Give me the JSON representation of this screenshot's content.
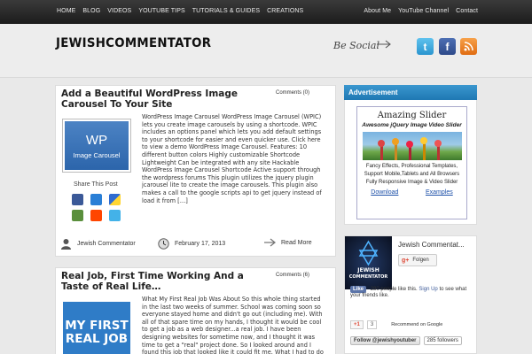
{
  "nav": {
    "left": [
      "HOME",
      "BLOG",
      "VIDEOS",
      "YOUTUBE TIPS",
      "TUTORIALS & GUIDES",
      "CREATIONS"
    ],
    "right": [
      "About Me",
      "YouTube Channel",
      "Contact"
    ]
  },
  "header": {
    "logo": "JEWISHCOMMENTATOR",
    "be_social": "Be Social"
  },
  "posts": [
    {
      "title": "Add a Beautiful WordPress Image Carousel To Your Site",
      "comments": "Comments (0)",
      "thumb_big": "WP",
      "thumb_small": "Image Carousel",
      "share_label": "Share This Post",
      "excerpt": "WordPress Image Carousel WordPress Image Carousel (WPIC) lets you create image carousels by using a shortcode. WPIC includes an options panel which lets you add default settings to your shortcode for easier and even quicker use.       Click here to view a demo WordPress Image Carousel. Features: 10 different button colors Highly customizable Shortcode Lightweight Can be integrated with any site Hackable WordPress Image Carousel Shortcode Active support through the wordpress forums This plugin utilizes the jquery plugin jcarousel lite to create the image carousels. This plugin also makes a call to the google scripts api to get jquery instead of load it from […]",
      "author": "Jewish Commentator",
      "date": "February 17, 2013",
      "read_more": "Read More"
    },
    {
      "title": "Real Job, First Time Working And a Taste of Real Life…",
      "comments": "Comments (6)",
      "thumb_text": [
        "MY FIRST",
        "REAL JOB"
      ],
      "excerpt": "What My First Real Job Was About So this whole thing started in the last two weeks of summer. School was coming soon so everyone stayed home and didn't go out (including me). With all of that spare time on my hands, I thought it would be cool to get a job as a web designer...a real job. I have been designing websites for sometime now, and I thought it was time to get a \"real\" project done. So I looked around and I found this job that looked like it could fit me. What I had to do"
    }
  ],
  "sidebar": {
    "ad_header": "Advertisement",
    "ad": {
      "title": "Amazing Slider",
      "subtitle": "Awesome jQuery Image Video Slider",
      "features": [
        "Fancy Effects, Professional Templates,",
        "Support Mobile,Tablets and All Browsers",
        "Fully Responsive Image & Video Slider"
      ],
      "download": "Download",
      "examples": "Examples"
    },
    "gplus": {
      "name": "Jewish Commentat...",
      "follow": "Folgen",
      "logo_text": [
        "JEWISH",
        "COMMENTATOR"
      ]
    },
    "facebook": {
      "like": "Like",
      "text": "280 people like this.",
      "signup": "Sign Up",
      "text2": "to see what your friends like."
    },
    "g1": {
      "label": "+1",
      "count": "3",
      "recommend": "Recommend on Google"
    },
    "twitter": {
      "follow": "Follow @jewishyoutuber",
      "followers": "285 followers"
    }
  },
  "colors": {
    "accent": "#2a86c2",
    "nav_bg": "#2a2a2a",
    "facebook": "#3b5998",
    "twitter": "#2a95cf",
    "rss": "#e06c12"
  }
}
